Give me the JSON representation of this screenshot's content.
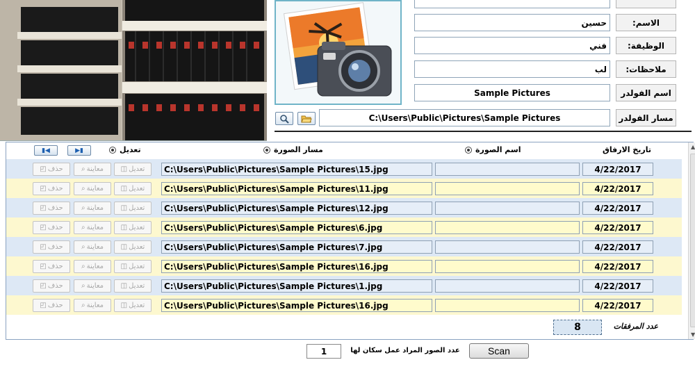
{
  "form": {
    "name_label": "الاسم:",
    "name_value": "حسين",
    "job_label": "الوظيفة:",
    "job_value": "فني",
    "notes_label": "ملاحظات:",
    "notes_value": "لب",
    "folder_name_label": "اسم الفولدر",
    "folder_name_value": "Sample Pictures",
    "folder_path_label": "مسار الفولدر",
    "folder_path_value": "C:\\Users\\Public\\Pictures\\Sample Pictures"
  },
  "grid": {
    "headers": {
      "date": "تاريخ الارفاق",
      "image_name": "اسم الصورة",
      "image_path": "مسار الصورة",
      "edit": "تعديل"
    },
    "row_buttons": {
      "edit": "تعديل",
      "preview": "معاينة",
      "delete": "حذف"
    },
    "rows": [
      {
        "path": "C:\\Users\\Public\\Pictures\\Sample Pictures\\15.jpg",
        "name": "",
        "date": "4/22/2017"
      },
      {
        "path": "C:\\Users\\Public\\Pictures\\Sample Pictures\\11.jpg",
        "name": "",
        "date": "4/22/2017"
      },
      {
        "path": "C:\\Users\\Public\\Pictures\\Sample Pictures\\12.jpg",
        "name": "",
        "date": "4/22/2017"
      },
      {
        "path": "C:\\Users\\Public\\Pictures\\Sample Pictures\\6.jpg",
        "name": "",
        "date": "4/22/2017"
      },
      {
        "path": "C:\\Users\\Public\\Pictures\\Sample Pictures\\7.jpg",
        "name": "",
        "date": "4/22/2017"
      },
      {
        "path": "C:\\Users\\Public\\Pictures\\Sample Pictures\\16.jpg",
        "name": "",
        "date": "4/22/2017"
      },
      {
        "path": "C:\\Users\\Public\\Pictures\\Sample Pictures\\1.jpg",
        "name": "",
        "date": "4/22/2017"
      },
      {
        "path": "C:\\Users\\Public\\Pictures\\Sample Pictures\\16.jpg",
        "name": "",
        "date": "4/22/2017"
      }
    ],
    "attachments_label": "عدد المرفقات",
    "attachments_count": "8"
  },
  "footer": {
    "scan_button": "Scan",
    "scan_count_label": "عدد الصور المراد عمل سكان لها",
    "scan_count_value": "1"
  },
  "icons": {
    "search": "magnifier-icon",
    "open_folder": "folder-open-icon",
    "first": "first-record-icon",
    "last": "last-record-icon"
  },
  "colors": {
    "row_blue": "#dde8f5",
    "row_yellow": "#fdf8cf",
    "accent": "#6fb4c8"
  }
}
